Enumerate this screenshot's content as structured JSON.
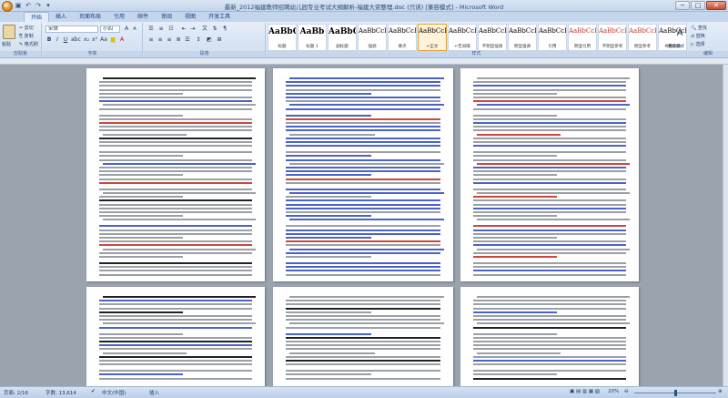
{
  "window": {
    "title": "最新_2012福建教师招聘幼儿园专业考试大纲解析-福建大资整理.doc (只读) [兼容模式] - Microsoft Word",
    "minimize": "─",
    "maximize": "□",
    "close": "✕"
  },
  "qat": [
    "save-icon",
    "undo-icon",
    "redo-icon",
    "customize-icon"
  ],
  "tabs": [
    "开始",
    "插入",
    "页面布局",
    "引用",
    "邮件",
    "审阅",
    "视图",
    "开发工具"
  ],
  "ribbon": {
    "clipboard": {
      "paste": "粘贴",
      "cut": "剪切",
      "copy": "复制",
      "format_painter": "格式刷",
      "label": "剪贴板"
    },
    "font": {
      "name": "宋体",
      "size": "小四",
      "label": "字体",
      "bold": "B",
      "italic": "I",
      "underline": "U"
    },
    "paragraph": {
      "label": "段落"
    },
    "styles": {
      "label": "样式",
      "items": [
        {
          "preview": "AaBbC",
          "name": "标题",
          "red": false,
          "big": true
        },
        {
          "preview": "AaBb",
          "name": "标题 1",
          "red": false,
          "big": true
        },
        {
          "preview": "AaBbC",
          "name": "副标题",
          "red": false,
          "big": true
        },
        {
          "preview": "AaBbCcD",
          "name": "强调",
          "red": false,
          "big": false
        },
        {
          "preview": "AaBbCcD",
          "name": "要点",
          "red": false,
          "big": false
        },
        {
          "preview": "AaBbCcD",
          "name": "↵正文",
          "red": false,
          "big": false,
          "selected": true
        },
        {
          "preview": "AaBbCcD",
          "name": "↵无间隔",
          "red": false,
          "big": false
        },
        {
          "preview": "AaBbCcD",
          "name": "不明显强调",
          "red": false,
          "big": false
        },
        {
          "preview": "AaBbCcD",
          "name": "明显强调",
          "red": false,
          "big": false
        },
        {
          "preview": "AaBbCcD",
          "name": "引用",
          "red": false,
          "big": false
        },
        {
          "preview": "AaBbCcD",
          "name": "明显引用",
          "red": true,
          "big": false
        },
        {
          "preview": "AaBbCcD",
          "name": "不明显参考",
          "red": true,
          "big": false
        },
        {
          "preview": "AaBbCcD",
          "name": "明显参考",
          "red": true,
          "big": false
        },
        {
          "preview": "AaBbCcI",
          "name": "书籍标题",
          "red": false,
          "big": false
        }
      ],
      "change_styles": "更改样式"
    },
    "editing": {
      "find": "查找",
      "replace": "替换",
      "select": "选择",
      "label": "编辑"
    }
  },
  "status": {
    "page": "页面: 2/16",
    "words": "字数: 13,614",
    "language": "中文(中国)",
    "mode": "插入",
    "zoom": "20%",
    "zoom_level": 0.2
  },
  "colors": {
    "accent": "#15428b",
    "blue_text": "#4a63c9",
    "red_text": "#d0453c"
  }
}
